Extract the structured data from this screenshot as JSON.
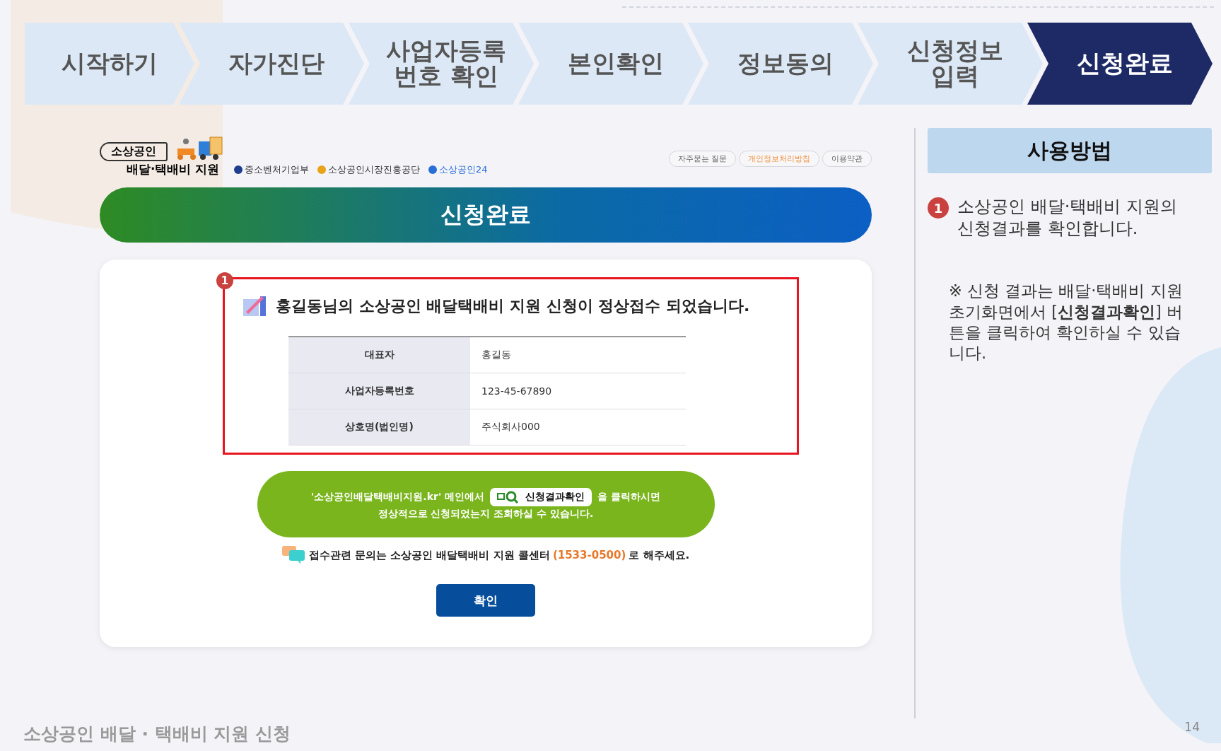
{
  "steps": [
    {
      "label": "시작하기",
      "selected": false
    },
    {
      "label": "자가진단",
      "selected": false
    },
    {
      "label": "사업자등록\n번호 확인",
      "selected": false
    },
    {
      "label": "본인확인",
      "selected": false
    },
    {
      "label": "정보동의",
      "selected": false
    },
    {
      "label": "신청정보\n입력",
      "selected": false
    },
    {
      "label": "신청완료",
      "selected": true
    }
  ],
  "site": {
    "logo_badge": "소상공인",
    "logo_title": "배달·택배비 지원",
    "agencies": [
      {
        "name": "중소벤처기업부",
        "color": "#1d3d8f"
      },
      {
        "name": "소상공인시장진흥공단",
        "color": "#e8a317"
      },
      {
        "name": "소상공인24",
        "color": "#2a6fd6"
      }
    ],
    "top_links": [
      {
        "label": "자주묻는 질문",
        "kind": "normal"
      },
      {
        "label": "개인정보처리방침",
        "kind": "highlight"
      },
      {
        "label": "이용약관",
        "kind": "normal"
      }
    ],
    "page_title": "신청완료",
    "marker": "1",
    "message": "홍길동님의 소상공인 배달택배비 지원 신청이 정상접수 되었습니다.",
    "table": [
      {
        "label": "대표자",
        "value": "홍길동"
      },
      {
        "label": "사업자등록번호",
        "value": "123-45-67890"
      },
      {
        "label": "상호명(법인명)",
        "value": "주식회사000"
      }
    ],
    "notice": {
      "before": "'소상공인배달택배비지원.kr' 메인에서",
      "button": "신청결과확인",
      "after": "을 클릭하시면",
      "line2": "정상적으로 신청되었는지 조회하실 수 있습니다."
    },
    "contact": {
      "before": "접수관련 문의는 소상공인 배달택배비 지원 콜센터",
      "phone": "(1533-0500)",
      "after": "로 해주세요."
    },
    "confirm_button": "확인"
  },
  "guide": {
    "title": "사용방법",
    "items": [
      {
        "marker": "1",
        "text": "소상공인 배달·택배비 지원의 신청결과를 확인합니다."
      }
    ],
    "note": "※ 신청 결과는 배달·택배비 지원 초기화면에서 [**신청결과확인**] 버튼을 클릭하여 확인하실 수 있습니다."
  },
  "footer": {
    "title": "소상공인 배달 · 택배비 지원 신청",
    "page": "14"
  }
}
